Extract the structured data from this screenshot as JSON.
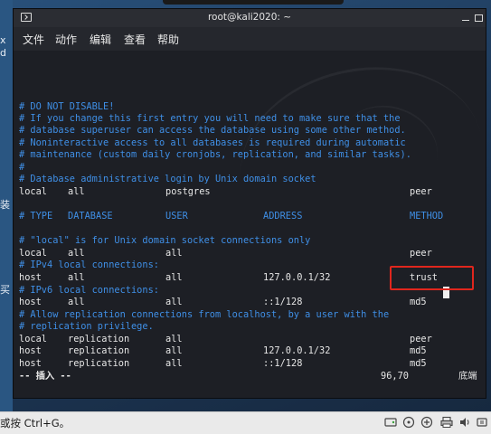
{
  "desktop": {
    "left_labels": [
      "x",
      "d",
      "装",
      "买"
    ]
  },
  "window": {
    "title": "root@kali2020: ~"
  },
  "menu": [
    "文件",
    "动作",
    "编辑",
    "查看",
    "帮助"
  ],
  "editor": {
    "comments": [
      "# DO NOT DISABLE!",
      "# If you change this first entry you will need to make sure that the",
      "# database superuser can access the database using some other method.",
      "# Noninteractive access to all databases is required during automatic",
      "# maintenance (custom daily cronjobs, replication, and similar tasks).",
      "#",
      "# Database administrative login by Unix domain socket"
    ],
    "row_admin": [
      "local",
      "all",
      "postgres",
      "",
      "peer"
    ],
    "header": [
      "# TYPE",
      "DATABASE",
      "USER",
      "ADDRESS",
      "METHOD"
    ],
    "comment_local": "# \"local\" is for Unix domain socket connections only",
    "row_local": [
      "local",
      "all",
      "all",
      "",
      "peer"
    ],
    "comment_ipv4": "# IPv4 local connections:",
    "row_ipv4": [
      "host",
      "all",
      "all",
      "127.0.0.1/32",
      "trust"
    ],
    "comment_ipv6": "# IPv6 local connections:",
    "row_ipv6": [
      "host",
      "all",
      "all",
      "::1/128",
      "md5"
    ],
    "comment_repl": [
      "# Allow replication connections from localhost, by a user with the",
      "# replication privilege."
    ],
    "row_repl1": [
      "local",
      "replication",
      "all",
      "",
      "peer"
    ],
    "row_repl2": [
      "host",
      "replication",
      "all",
      "127.0.0.1/32",
      "md5"
    ],
    "row_repl3": [
      "host",
      "replication",
      "all",
      "::1/128",
      "md5"
    ],
    "status": {
      "mode": "-- 插入 --",
      "position": "96,70",
      "scroll": "底端"
    }
  },
  "taskbar": {
    "hint": "或按 Ctrl+G。"
  },
  "colors": {
    "comment": "#3f8fe6",
    "text": "#e6e6e6",
    "highlight": "#e0261d"
  }
}
